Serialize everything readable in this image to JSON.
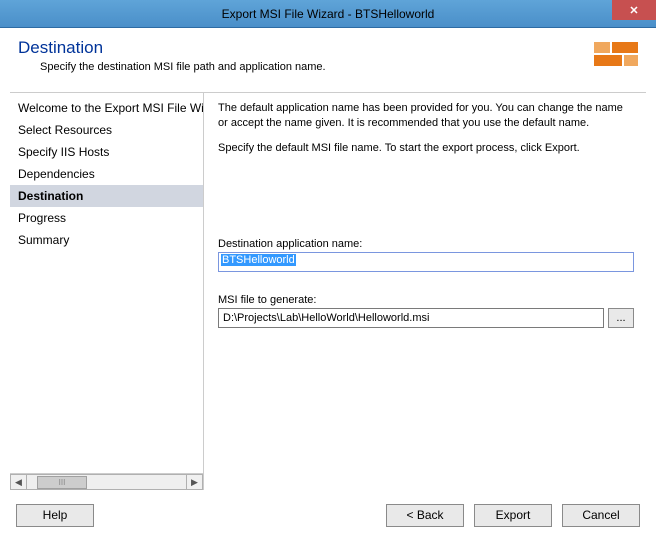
{
  "window": {
    "title": "Export MSI File Wizard - BTSHelloworld",
    "close": "✕"
  },
  "header": {
    "title": "Destination",
    "subtitle": "Specify the destination MSI file path and application name."
  },
  "sidebar": {
    "items": [
      {
        "label": "Welcome to the Export MSI File Wiz",
        "selected": false
      },
      {
        "label": "Select Resources",
        "selected": false
      },
      {
        "label": "Specify IIS Hosts",
        "selected": false
      },
      {
        "label": "Dependencies",
        "selected": false
      },
      {
        "label": "Destination",
        "selected": true
      },
      {
        "label": "Progress",
        "selected": false
      },
      {
        "label": "Summary",
        "selected": false
      }
    ],
    "thumb_label": "III"
  },
  "main": {
    "intro1": "The default application name has been provided for you. You can change the name or accept the name given. It is recommended that you use the default name.",
    "intro2": "Specify the default MSI file name. To start the export process, click Export.",
    "app_name_label": "Destination application name:",
    "app_name_value": "BTSHelloworld",
    "msi_label": "MSI file to generate:",
    "msi_value": "D:\\Projects\\Lab\\HelloWorld\\Helloworld.msi",
    "browse": "..."
  },
  "footer": {
    "help": "Help",
    "back": "< Back",
    "export": "Export",
    "cancel": "Cancel"
  }
}
